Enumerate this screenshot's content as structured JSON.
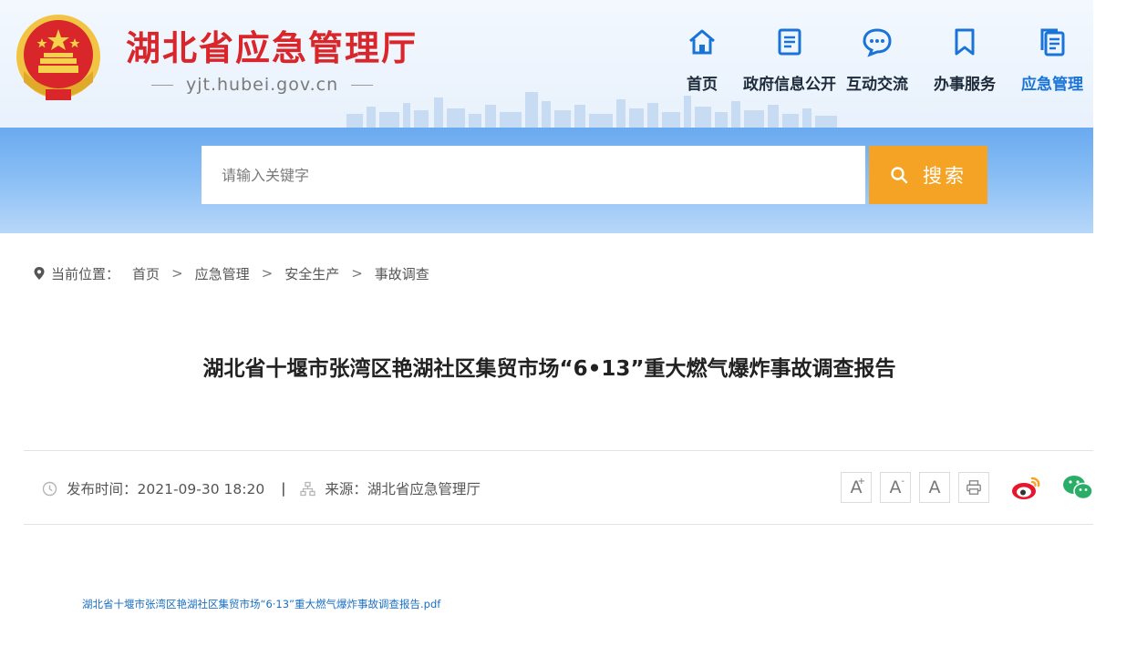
{
  "header": {
    "site_title": "湖北省应急管理厅",
    "site_domain": "yjt.hubei.gov.cn",
    "emblem_icon": "national-emblem-icon",
    "nav": [
      {
        "label": "首页",
        "icon": "home-icon"
      },
      {
        "label": "政府信息公开",
        "icon": "document-icon"
      },
      {
        "label": "互动交流",
        "icon": "chat-bubble-icon"
      },
      {
        "label": "办事服务",
        "icon": "bookmark-icon"
      },
      {
        "label": "应急管理",
        "icon": "file-copy-icon",
        "active": true
      }
    ]
  },
  "search": {
    "placeholder": "请输入关键字",
    "button_label": "搜索"
  },
  "breadcrumb": {
    "label": "当前位置：",
    "items": [
      "首页",
      "应急管理",
      "安全生产",
      "事故调查"
    ],
    "separator": ">"
  },
  "article": {
    "title": "湖北省十堰市张湾区艳湖社区集贸市场“6•13”重大燃气爆炸事故调查报告",
    "publish_label": "发布时间：2021-09-30 18:20",
    "divider": "|",
    "source_label": "来源：湖北省应急管理厅",
    "attachment": "湖北省十堰市张湾区艳湖社区集贸市场“6·13”重大燃气爆炸事故调查报告.pdf"
  },
  "tools": {
    "font_larger": "A",
    "font_smaller": "A",
    "font_default": "A",
    "plus": "+",
    "minus": "-"
  },
  "colors": {
    "title_red": "#d8262b",
    "accent_blue": "#1a74d8",
    "search_orange": "#f4a325",
    "band_blue": "#6aaaf0"
  }
}
